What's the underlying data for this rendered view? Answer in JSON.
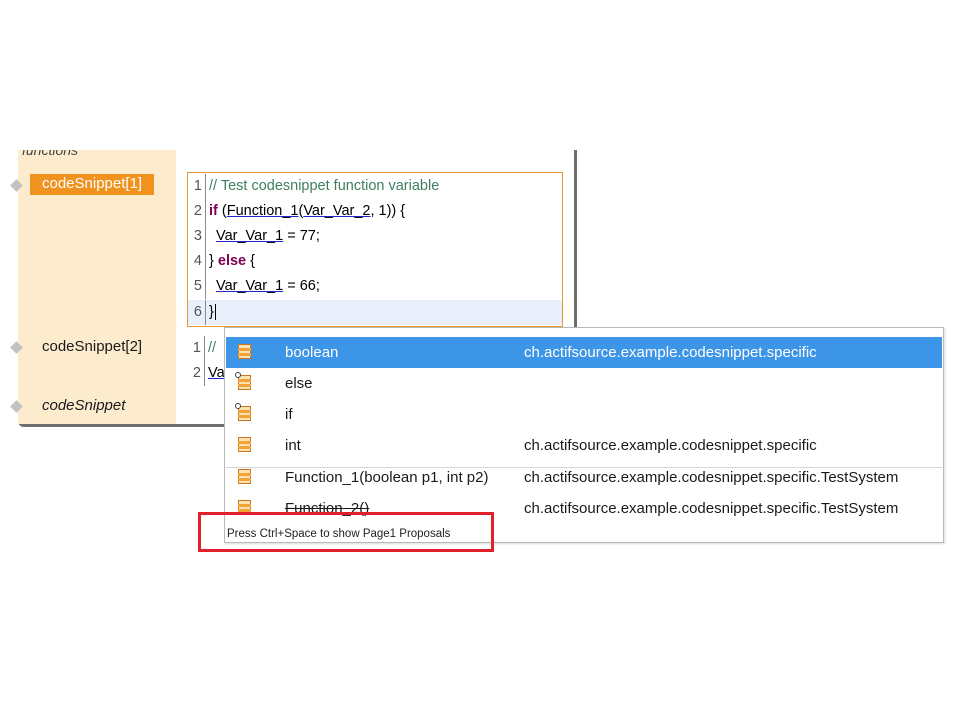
{
  "panel": {
    "cut_label": "functions",
    "rows": [
      {
        "label": "codeSnippet[1]"
      },
      {
        "label": "codeSnippet[2]"
      },
      {
        "label": "codeSnippet"
      }
    ]
  },
  "editor1": {
    "lines": [
      {
        "num": "1",
        "comment": "// Test codesnippet function variable"
      },
      {
        "num": "2",
        "kw": "if",
        "t1": " (",
        "fn": "Function_1",
        "t2": "(",
        "var": "Var_Var_2",
        "t3": ", 1)) {"
      },
      {
        "num": "3",
        "var": "Var_Var_1",
        "t1": " = 77;"
      },
      {
        "num": "4",
        "t0": "} ",
        "kw": "else",
        "t1": " {"
      },
      {
        "num": "5",
        "var": "Var_Var_1",
        "t1": " = 66;"
      },
      {
        "num": "6",
        "t0": "}"
      }
    ]
  },
  "editor2": {
    "lines": [
      {
        "num": "1",
        "text": "//"
      },
      {
        "num": "2",
        "text": "Va"
      }
    ]
  },
  "popup": {
    "proposals": [
      {
        "name": "boolean",
        "package": "ch.actifsource.example.codesnippet.specific",
        "icon": "type-icon",
        "selected": true
      },
      {
        "name": "else",
        "package": "",
        "icon": "keyword-icon"
      },
      {
        "name": "if",
        "package": "",
        "icon": "keyword-icon"
      },
      {
        "name": "int",
        "package": "ch.actifsource.example.codesnippet.specific",
        "icon": "type-icon"
      },
      {
        "name": "Function_1(boolean p1, int p2)",
        "package": "ch.actifsource.example.codesnippet.specific.TestSystem",
        "icon": "function-icon"
      },
      {
        "name": "Function_2()",
        "package": "ch.actifsource.example.codesnippet.specific.TestSystem",
        "icon": "function-icon"
      }
    ],
    "status": "Press Ctrl+Space to show Page1 Proposals"
  },
  "colors": {
    "selection_orange": "#f0921e",
    "panel_bg": "#fdebcd",
    "popup_selection": "#3d95e7",
    "keyword": "#7f0055",
    "comment": "#3f7f5f",
    "highlight_box": "#e0202a"
  }
}
